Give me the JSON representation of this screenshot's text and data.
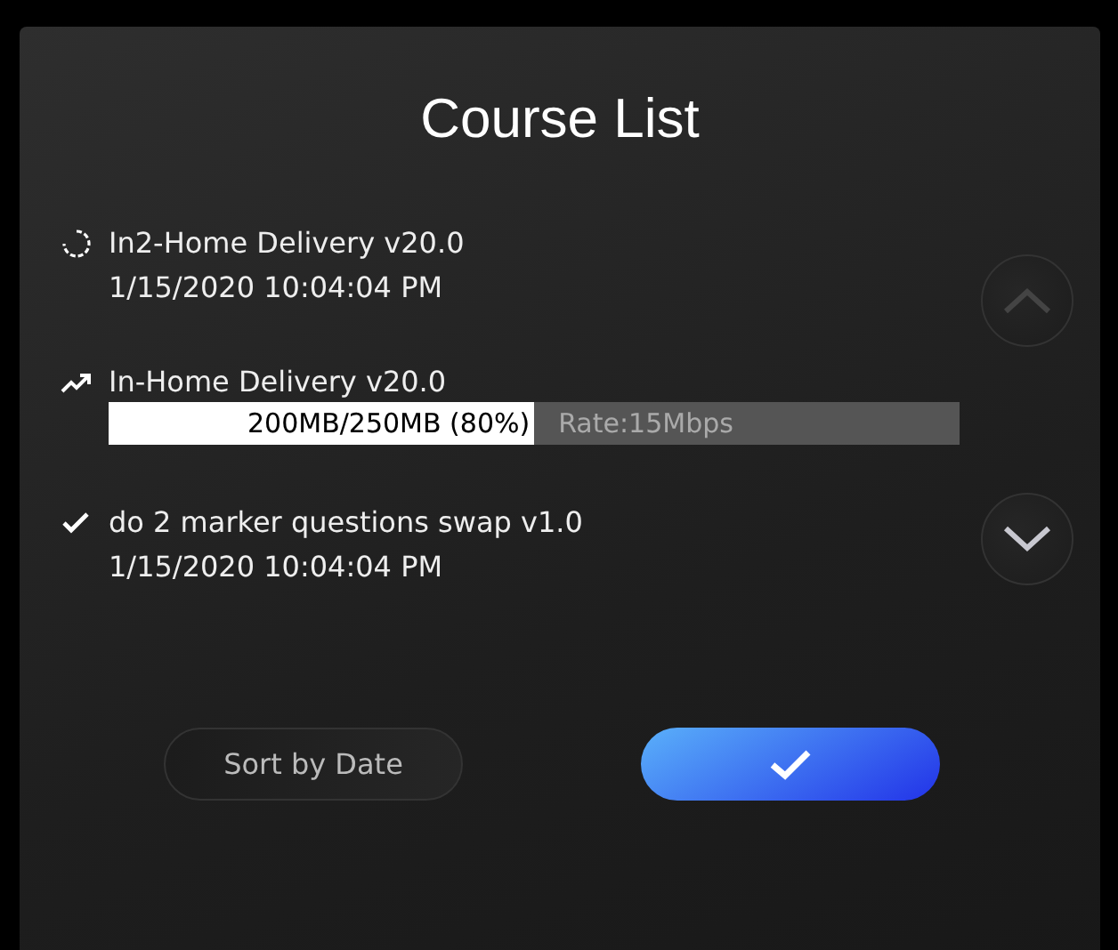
{
  "dialog": {
    "title": "Course List"
  },
  "courses": [
    {
      "kind": "loading",
      "name": "In2-Home Delivery v20.0",
      "date": "1/15/2020 10:04:04 PM"
    },
    {
      "kind": "downloading",
      "name": "In-Home Delivery v20.0",
      "progress": {
        "level": 0.5,
        "size": "200MB/250MB (80%)",
        "rate": "Rate:15Mbps"
      }
    },
    {
      "kind": "done",
      "name": "do 2 marker questions swap v1.0",
      "date": "1/15/2020 10:04:04 PM"
    }
  ],
  "buttons": {
    "sort": "Sort by Date"
  }
}
